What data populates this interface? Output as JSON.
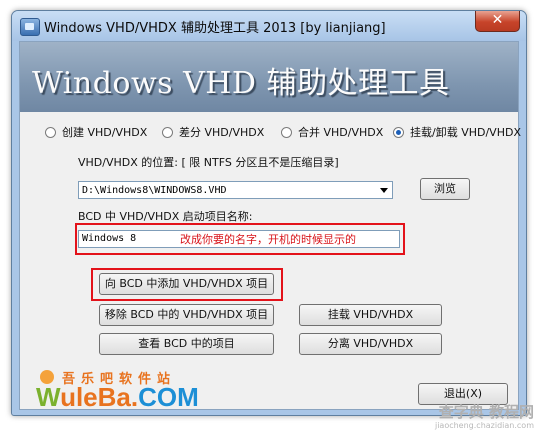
{
  "window": {
    "title": "Windows VHD/VHDX 辅助处理工具 2013 [by lianjiang]",
    "close_symbol": "✕"
  },
  "banner": {
    "title": "Windows VHD 辅助处理工具"
  },
  "modes": [
    {
      "label": "创建 VHD/VHDX",
      "checked": false
    },
    {
      "label": "差分 VHD/VHDX",
      "checked": false
    },
    {
      "label": "合并 VHD/VHDX",
      "checked": false
    },
    {
      "label": "挂载/卸载 VHD/VHDX",
      "checked": true
    }
  ],
  "location": {
    "label": "VHD/VHDX 的位置: [ 限 NTFS 分区且不是压缩目录]",
    "value": "D:\\Windows8\\WINDOWS8.VHD",
    "browse_label": "浏览"
  },
  "bcd_name": {
    "label": "BCD 中 VHD/VHDX 启动项目名称:",
    "value": "Windows 8",
    "annotation": "改成你要的名字，开机的时候显示的"
  },
  "actions": {
    "add_bcd": "向 BCD 中添加 VHD/VHDX 项目",
    "remove_bcd": "移除 BCD 中的 VHD/VHDX 项目",
    "view_bcd": "查看 BCD 中的项目",
    "mount": "挂载 VHD/VHDX",
    "detach": "分离 VHD/VHDX",
    "exit": "退出(X)"
  },
  "logo": {
    "cn": "吾乐吧软件站",
    "en_w": "W",
    "en_rest": "uleBa.",
    "en_com": "COM"
  },
  "watermark": {
    "main": "查字典 教程网",
    "sub": "jiaocheng.chazidian.com"
  },
  "colors": {
    "highlight": "#e3121a",
    "banner": "#7f96b0",
    "titlebar": "#a9c6e7"
  }
}
